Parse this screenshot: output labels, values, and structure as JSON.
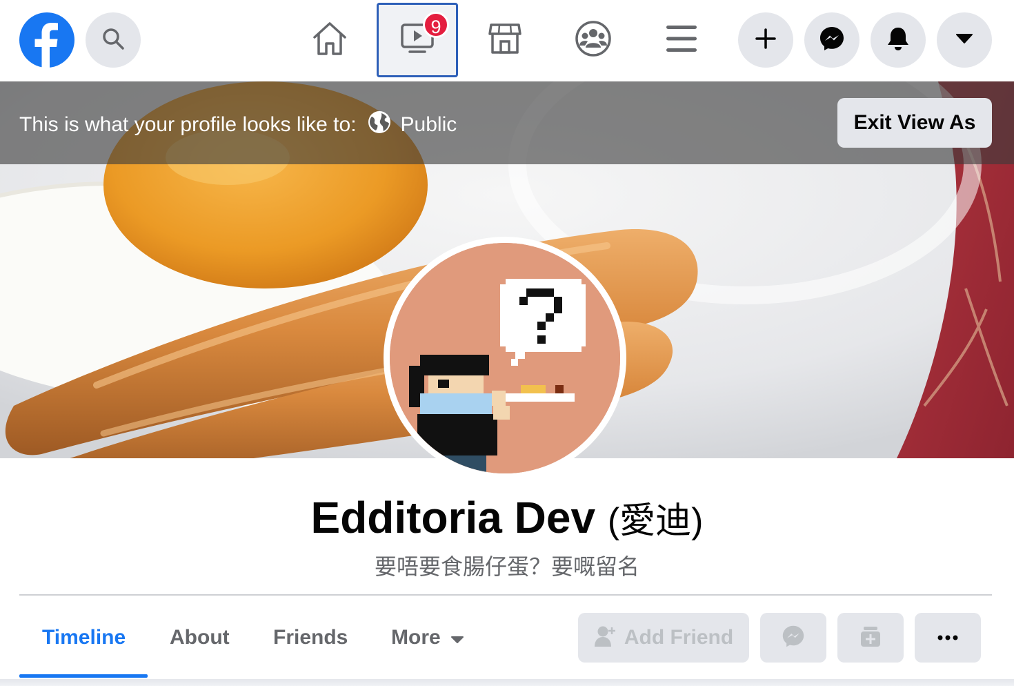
{
  "nav": {
    "badges": {
      "watch": "9"
    },
    "icons": [
      "facebook-logo-icon",
      "search-icon",
      "home-icon",
      "watch-icon",
      "marketplace-icon",
      "groups-icon",
      "menu-icon",
      "plus-icon",
      "messenger-icon",
      "bell-icon",
      "caret-down-icon"
    ]
  },
  "view_as": {
    "text": "This is what your profile looks like to:",
    "audience": "Public",
    "exit_label": "Exit View As"
  },
  "profile": {
    "name": "Edditoria Dev",
    "alt_name": "(愛迪)",
    "bio": "要唔要食腸仔蛋？要嘅留名"
  },
  "tabs": [
    {
      "label": "Timeline",
      "active": true
    },
    {
      "label": "About"
    },
    {
      "label": "Friends"
    },
    {
      "label": "More"
    }
  ],
  "actions": {
    "add_friend_label": "Add Friend"
  },
  "colors": {
    "accent": "#1877f2",
    "badge": "#e41e3f",
    "button_bg": "#e4e6eb",
    "muted_text": "#65676b"
  }
}
